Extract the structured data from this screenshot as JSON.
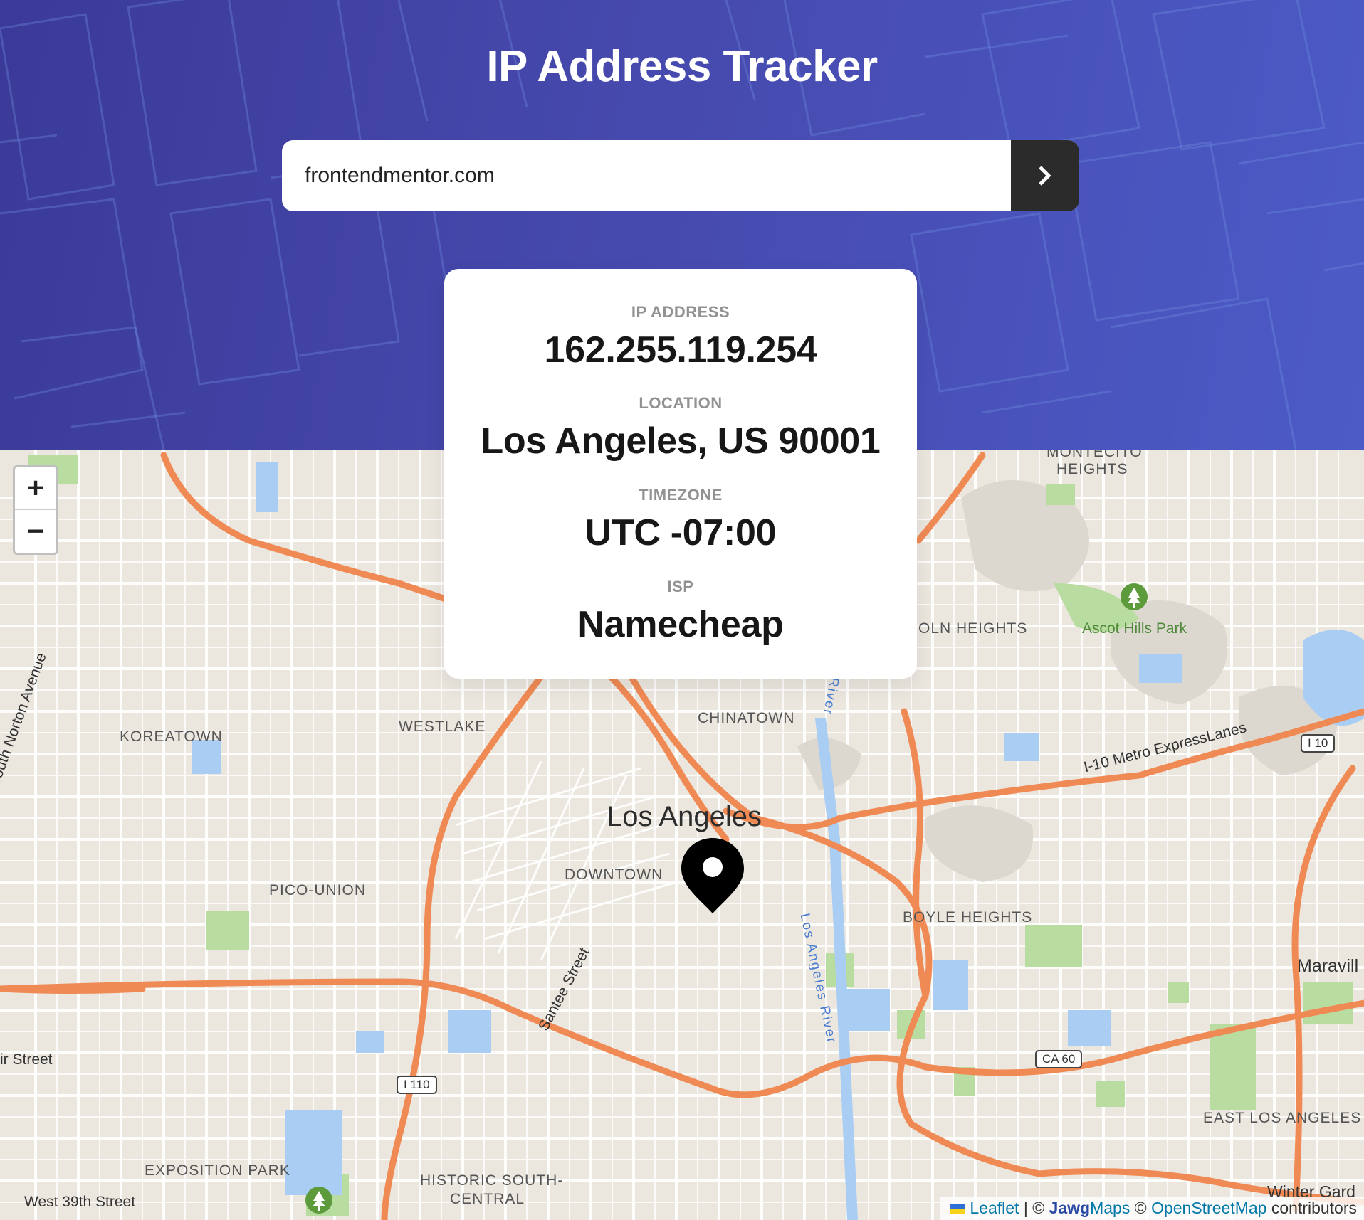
{
  "header": {
    "title": "IP Address Tracker",
    "search_value": "frontendmentor.com",
    "submit_icon": "chevron-right-icon"
  },
  "info": {
    "ip": {
      "label": "IP ADDRESS",
      "value": "162.255.119.254"
    },
    "location": {
      "label": "LOCATION",
      "value": "Los Angeles, US 90001"
    },
    "timezone": {
      "label": "TIMEZONE",
      "value": "UTC -07:00"
    },
    "isp": {
      "label": "ISP",
      "value": "Namecheap"
    }
  },
  "map": {
    "zoom_in": "+",
    "zoom_out": "−",
    "labels": {
      "montecito": "MONTECITO",
      "heights": "HEIGHTS",
      "lincoln_heights": "OLN HEIGHTS",
      "ascot_hills_park": "Ascot Hills Park",
      "koreatown": "KOREATOWN",
      "westlake": "WESTLAKE",
      "chinatown": "CHINATOWN",
      "los_angeles": "Los Angeles",
      "downtown": "DOWNTOWN",
      "pico_union": "PICO-UNION",
      "boyle_heights": "BOYLE HEIGHTS",
      "maravilla": "Maravill",
      "south_norton_avenue": "South Norton Avenue",
      "santee_street": "Santee Street",
      "los_angeles_river": "Los Angeles River",
      "river": "River",
      "i10_express": "I-10 Metro ExpressLanes",
      "fair_street": "ir Street",
      "east_los_angeles": "EAST LOS ANGELES",
      "exposition_park": "EXPOSITION PARK",
      "historic_south_central_1": "HISTORIC SOUTH-",
      "historic_south_central_2": "CENTRAL",
      "west_39th_street": "West 39th Street",
      "winter_gardens": "Winter Gard"
    },
    "shields": {
      "i110": "I 110",
      "i10": "I 10",
      "ca60": "CA 60"
    },
    "attribution": {
      "leaflet": "Leaflet",
      "separator": " | © ",
      "jawg_a": "Jawg",
      "jawg_b": "Maps",
      "copy": " © ",
      "osm": "OpenStreetMap",
      "contributors": " contributors"
    }
  },
  "colors": {
    "header_start": "#3b3a98",
    "header_end": "#4c5bc7",
    "button": "#2b2b2b",
    "highway": "#f08a55",
    "water": "#a9cdf3",
    "park": "#b9dca0"
  }
}
